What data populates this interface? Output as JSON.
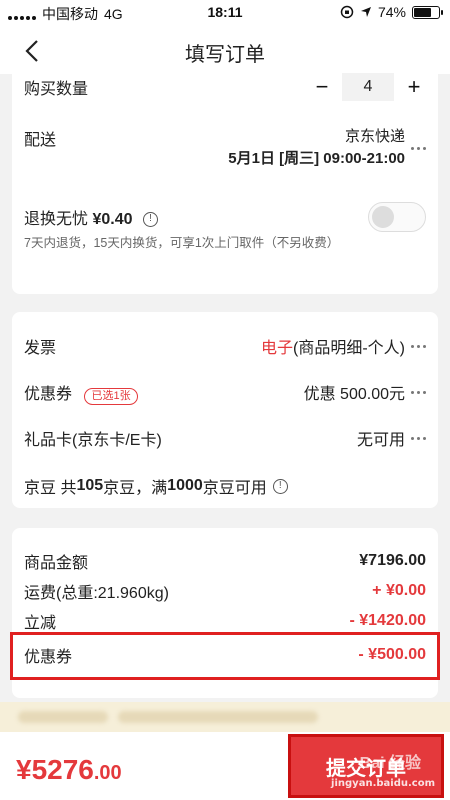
{
  "status_bar": {
    "carrier": "中国移动",
    "network": "4G",
    "time": "18:11",
    "battery": "74%",
    "battery_level": 0.74
  },
  "nav": {
    "title": "填写订单"
  },
  "quantity": {
    "label": "购买数量",
    "value": "4",
    "minus": "−",
    "plus": "+"
  },
  "shipping": {
    "label": "配送",
    "method": "京东快递",
    "datetime": "5月1日 [周三] 09:00-21:00"
  },
  "return_insurance": {
    "label": "退换无忧",
    "price": "¥0.40",
    "desc": "7天内退货，15天内换货，可享1次上门取件（不另收费）",
    "enabled": false
  },
  "invoice": {
    "label": "发票",
    "type": "电子",
    "detail": "(商品明细-个人)"
  },
  "coupon": {
    "label": "优惠券",
    "badge": "已选1张",
    "value": "优惠 500.00元"
  },
  "giftcard": {
    "label": "礼品卡(京东卡/E卡)",
    "value": "无可用"
  },
  "jingdou": {
    "prefix": "京豆  共",
    "count": "105",
    "mid": "京豆，满",
    "threshold": "1000",
    "suffix": "京豆可用"
  },
  "summary": {
    "items": [
      {
        "label": "商品金额",
        "value": "¥7196.00"
      },
      {
        "label": "运费(总重:21.960kg)",
        "value": "+ ¥0.00"
      },
      {
        "label": "立减",
        "value": "- ¥1420.00"
      },
      {
        "label": "优惠券",
        "value": "- ¥500.00"
      }
    ]
  },
  "footer": {
    "total_main": "¥5276",
    "total_decimal": ".00",
    "submit": "提交订单"
  },
  "watermark": {
    "line1": "Bai  经验",
    "line2": "jingyan.baidu.com"
  },
  "colors": {
    "accent": "#e4393c",
    "highlight_border": "#e02020"
  }
}
